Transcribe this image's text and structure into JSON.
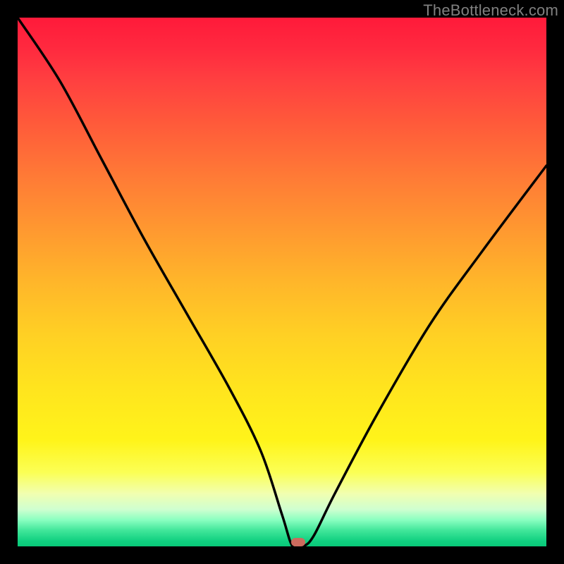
{
  "watermark": "TheBottleneck.com",
  "chart_data": {
    "type": "line",
    "title": "",
    "xlabel": "",
    "ylabel": "",
    "xlim": [
      0,
      100
    ],
    "ylim": [
      0,
      100
    ],
    "grid": false,
    "legend": false,
    "series": [
      {
        "name": "bottleneck-curve",
        "x": [
          0,
          8,
          16,
          24,
          32,
          40,
          46,
          50,
          52,
          54,
          56,
          60,
          68,
          78,
          88,
          100
        ],
        "values": [
          100,
          88,
          73,
          58,
          44,
          30,
          18,
          6,
          0,
          0,
          2,
          10,
          25,
          42,
          56,
          72
        ]
      }
    ],
    "annotations": [
      {
        "name": "optimal-marker",
        "x": 53,
        "y": 0.8
      }
    ],
    "background_gradient": {
      "top": "#ff1a3a",
      "mid": "#ffe41e",
      "bottom": "#09c878"
    }
  }
}
